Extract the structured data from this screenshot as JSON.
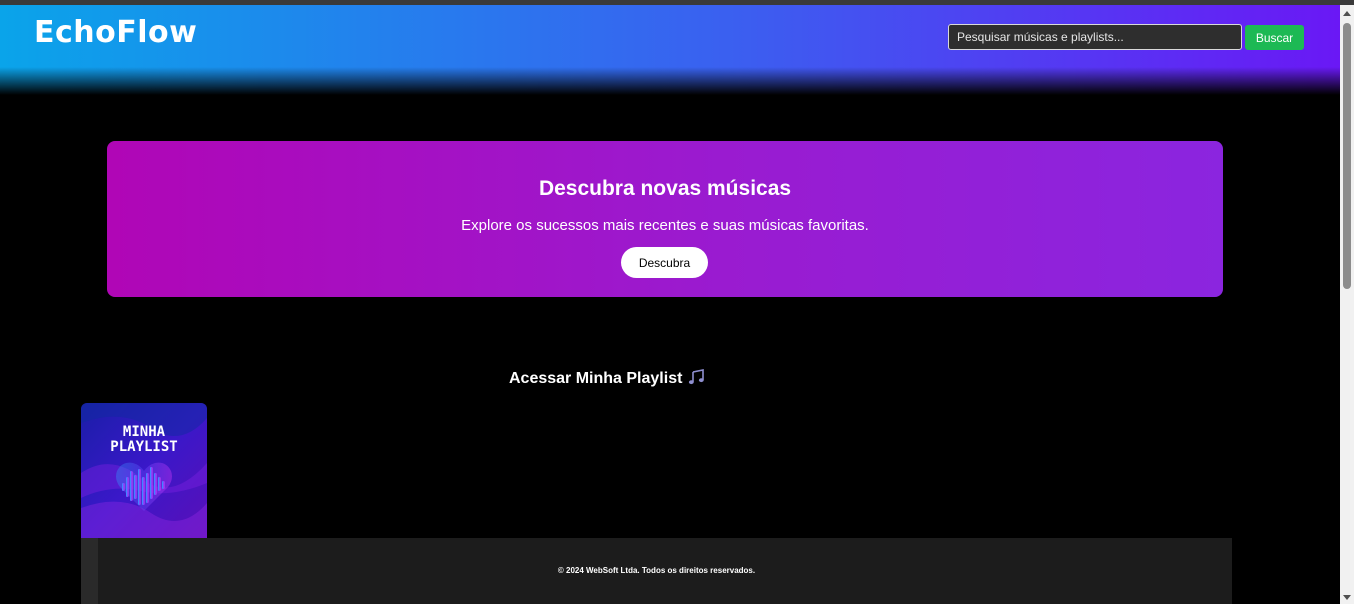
{
  "header": {
    "logo": "EchoFlow",
    "search_placeholder": "Pesquisar músicas e playlists...",
    "search_button": "Buscar"
  },
  "hero": {
    "title": "Descubra novas músicas",
    "subtitle": "Explore os sucessos mais recentes e suas músicas favoritas.",
    "button": "Descubra"
  },
  "playlist_section": {
    "title": "Acessar Minha Playlist",
    "title_icon": "music-notes-icon",
    "card": {
      "line1": "MINHA",
      "line2": "PLAYLIST"
    }
  },
  "footer": {
    "text": "© 2024 WebSoft Ltda. Todos os direitos reservados."
  },
  "colors": {
    "header_gradient_start": "#0aa4ea",
    "header_gradient_end": "#6a18f5",
    "hero_gradient_start": "#b006b6",
    "hero_gradient_end": "#8b25df",
    "search_button": "#1db954",
    "background": "#000000",
    "footer": "#1c1c1c"
  }
}
